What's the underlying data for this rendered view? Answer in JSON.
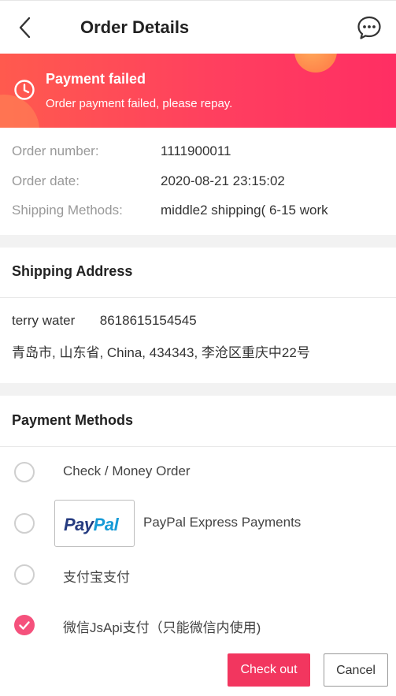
{
  "header": {
    "title": "Order Details",
    "back_icon": "chevron-left-icon",
    "chat_icon": "chat-bubble-icon"
  },
  "status_banner": {
    "icon": "clock-icon",
    "title": "Payment failed",
    "message": "Order payment failed, please repay.",
    "gradient_start": "#ff5a4e",
    "gradient_end": "#ff2e63"
  },
  "order_info": {
    "rows": [
      {
        "label": "Order number:",
        "value": "1111900011"
      },
      {
        "label": "Order date:",
        "value": "2020-08-21 23:15:02"
      },
      {
        "label": "Shipping Methods:",
        "value": "middle2 shipping( 6-15 work"
      }
    ]
  },
  "shipping_address": {
    "title": "Shipping Address",
    "name": "terry water",
    "phone": "8618615154545",
    "address": "青岛市, 山东省, China, 434343, 李沧区重庆中22号"
  },
  "payment_methods": {
    "title": "Payment Methods",
    "options": [
      {
        "label": "Check / Money Order",
        "selected": false
      },
      {
        "label": "PayPal Express Payments",
        "selected": false,
        "logo_pay": "Pay",
        "logo_pal": "Pal"
      },
      {
        "label": "支付宝支付",
        "selected": false
      },
      {
        "label": "微信JsApi支付（只能微信内使用)",
        "selected": true
      }
    ],
    "accent_color": "#f5517c"
  },
  "actions": {
    "checkout_label": "Check out",
    "cancel_label": "Cancel",
    "checkout_color": "#f2365f"
  }
}
